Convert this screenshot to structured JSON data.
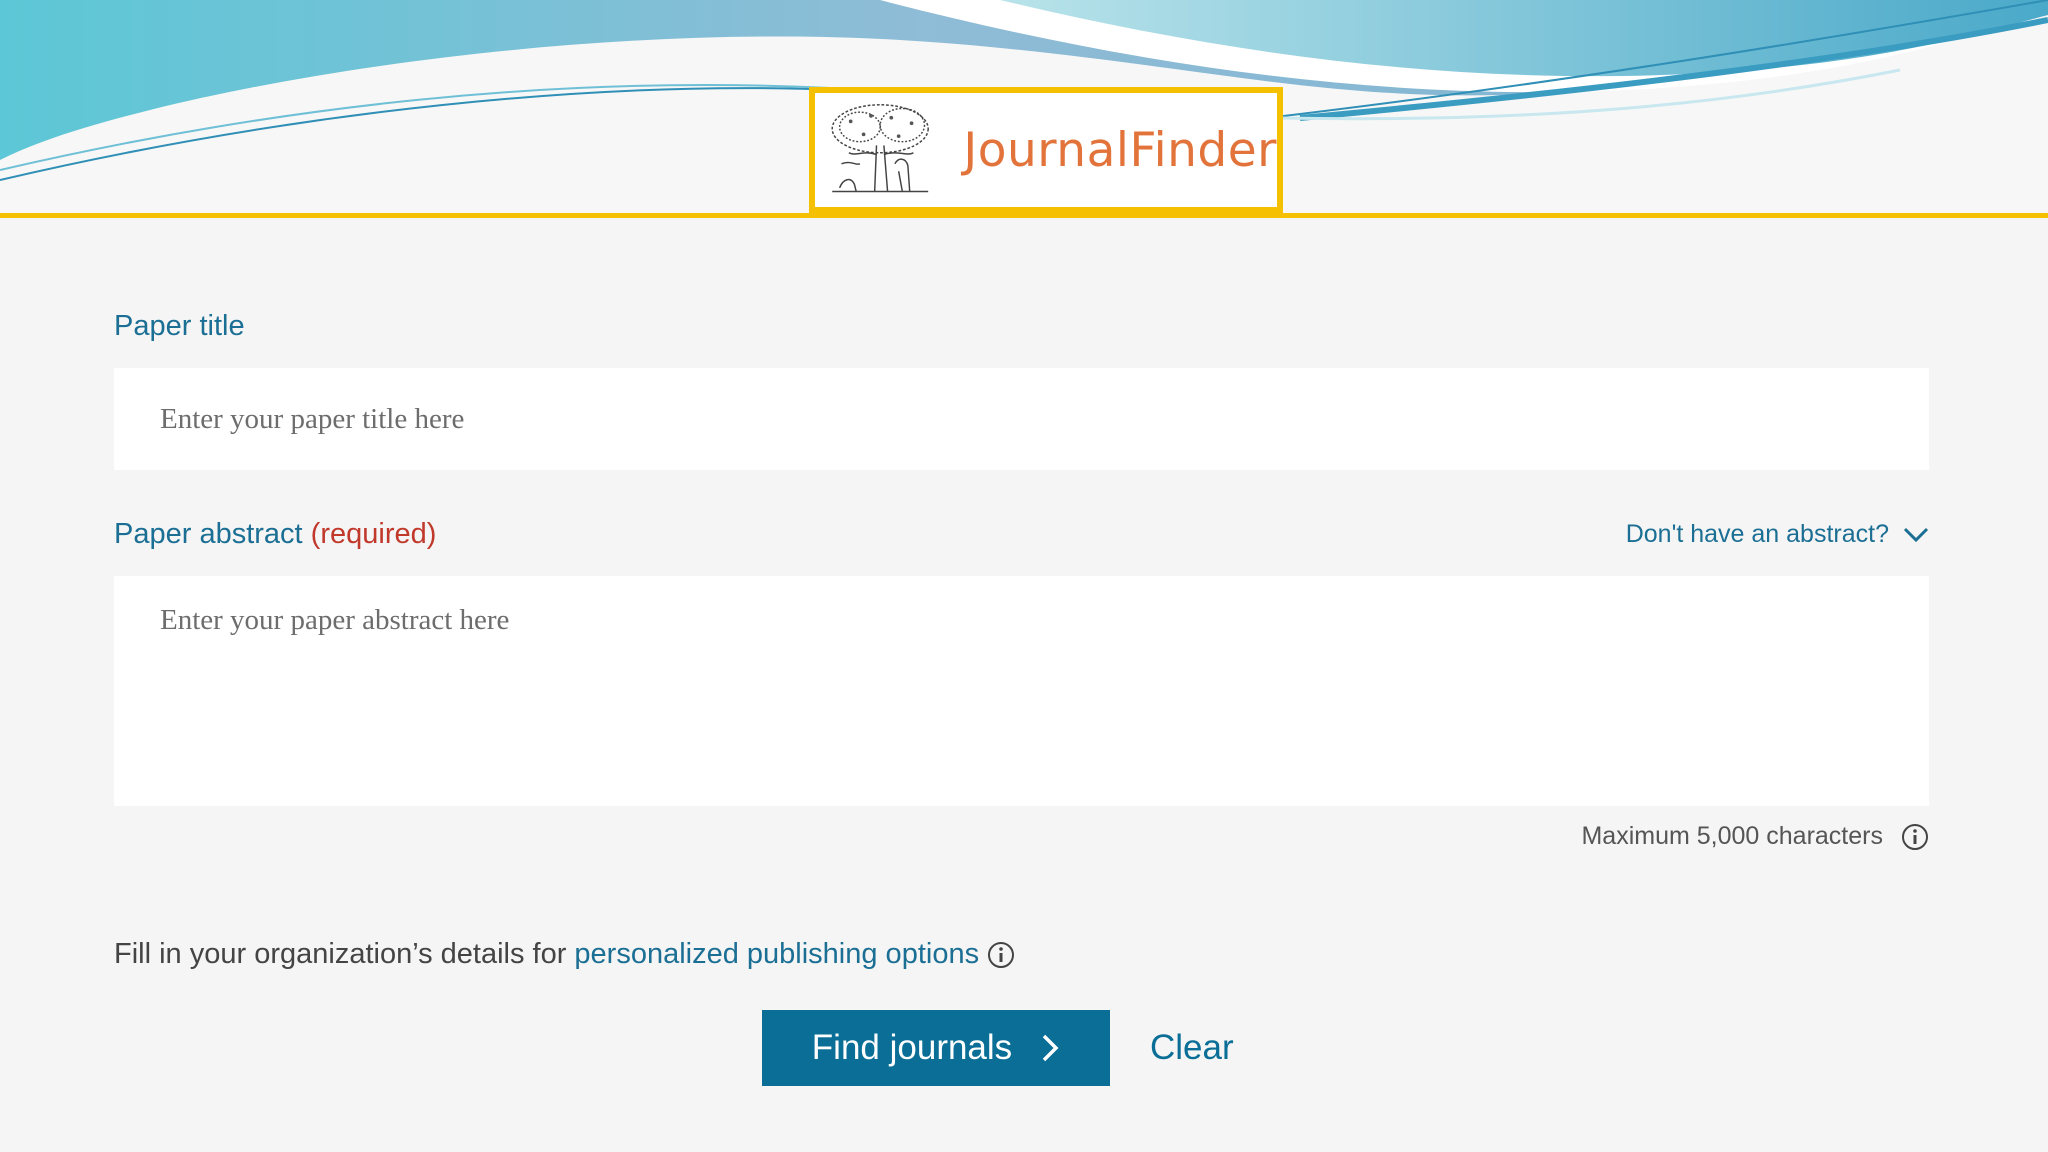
{
  "app": {
    "logo_text": "JournalFinder"
  },
  "form": {
    "title_label": "Paper title",
    "title_placeholder": "Enter your paper title here",
    "title_value": "",
    "abstract_label": "Paper abstract",
    "abstract_required": "(required)",
    "abstract_placeholder": "Enter your paper abstract here",
    "abstract_value": "",
    "no_abstract_toggle": "Don't have an abstract?",
    "max_chars_note": "Maximum 5,000 characters"
  },
  "organization": {
    "prefix_text": "Fill in your organization’s details for",
    "link_text": "personalized publishing options"
  },
  "actions": {
    "find_label": "Find journals",
    "clear_label": "Clear"
  },
  "icons": {
    "toggle": "chevron-down-icon",
    "find": "chevron-right-icon",
    "info": "info-icon",
    "logo": "tree-logo-icon"
  },
  "colors": {
    "accent": "#1c6f94",
    "button": "#0a6e96",
    "brand_yellow": "#f5c000",
    "logo_text": "#e2733a",
    "required": "#c0392b"
  }
}
